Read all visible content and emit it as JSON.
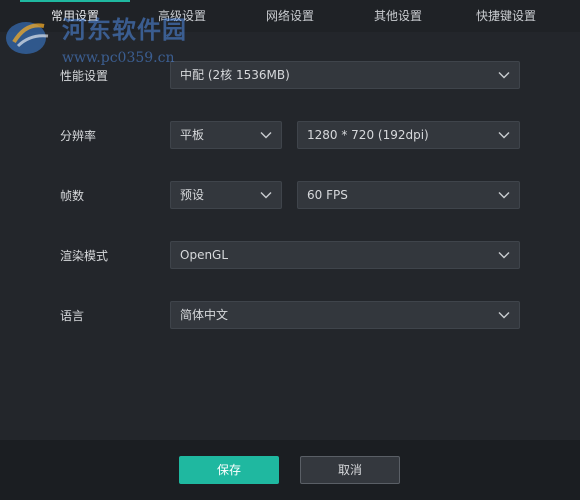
{
  "tabs": [
    {
      "label": "常用设置",
      "active": true
    },
    {
      "label": "高级设置",
      "active": false
    },
    {
      "label": "网络设置",
      "active": false
    },
    {
      "label": "其他设置",
      "active": false
    },
    {
      "label": "快捷键设置",
      "active": false
    }
  ],
  "settings": {
    "performance": {
      "label": "性能设置",
      "value": "中配 (2核 1536MB)"
    },
    "resolution": {
      "label": "分辨率",
      "preset": "平板",
      "value": "1280 * 720 (192dpi)"
    },
    "fps": {
      "label": "帧数",
      "preset": "预设",
      "value": "60 FPS"
    },
    "render_mode": {
      "label": "渲染模式",
      "value": "OpenGL"
    },
    "language": {
      "label": "语言",
      "value": "简体中文"
    }
  },
  "footer": {
    "save_label": "保存",
    "cancel_label": "取消"
  },
  "watermark": {
    "title": "河东软件园",
    "url": "www.pc0359.cn"
  },
  "colors": {
    "accent": "#1fb8a0",
    "background": "#23262b",
    "field": "#33373d"
  },
  "icons": {
    "dropdown": "chevron-down-icon",
    "logo": "watermark-logo-icon"
  }
}
